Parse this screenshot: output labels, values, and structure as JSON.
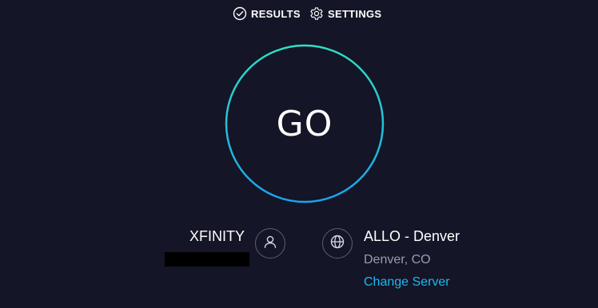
{
  "nav": {
    "results_label": "RESULTS",
    "settings_label": "SETTINGS",
    "results_icon": "check-circle-icon",
    "settings_icon": "gear-icon"
  },
  "go_button": {
    "label": "GO"
  },
  "isp": {
    "name": "XFINITY",
    "icon": "user-icon"
  },
  "server": {
    "name": "ALLO - Denver",
    "location": "Denver, CO",
    "change_label": "Change Server",
    "icon": "globe-icon"
  },
  "colors": {
    "background": "#141526",
    "ring_start": "#2de0c2",
    "ring_end": "#1aa4ee",
    "link": "#1cb8f0",
    "muted_text": "#9a9bb1"
  }
}
